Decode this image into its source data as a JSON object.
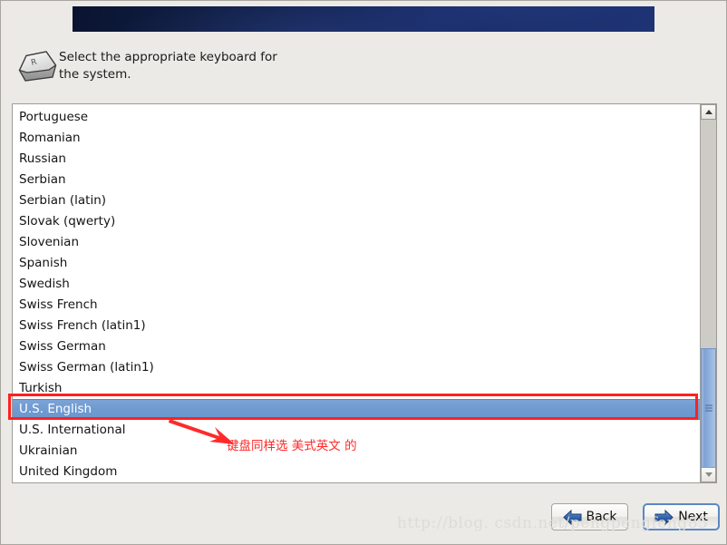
{
  "window": {
    "background_color": "#eceae6",
    "banner_color_start": "#0a1430",
    "banner_color_end": "#1e3374"
  },
  "header": {
    "icon": "keyboard-key-icon",
    "icon_letter": "R",
    "prompt": "Select the appropriate keyboard for\nthe system."
  },
  "keyboard_list": {
    "items": [
      {
        "label": "Portuguese",
        "selected": false
      },
      {
        "label": "Romanian",
        "selected": false
      },
      {
        "label": "Russian",
        "selected": false
      },
      {
        "label": "Serbian",
        "selected": false
      },
      {
        "label": "Serbian (latin)",
        "selected": false
      },
      {
        "label": "Slovak (qwerty)",
        "selected": false
      },
      {
        "label": "Slovenian",
        "selected": false
      },
      {
        "label": "Spanish",
        "selected": false
      },
      {
        "label": "Swedish",
        "selected": false
      },
      {
        "label": "Swiss French",
        "selected": false
      },
      {
        "label": "Swiss French (latin1)",
        "selected": false
      },
      {
        "label": "Swiss German",
        "selected": false
      },
      {
        "label": "Swiss German (latin1)",
        "selected": false
      },
      {
        "label": "Turkish",
        "selected": false
      },
      {
        "label": "U.S. English",
        "selected": true
      },
      {
        "label": "U.S. International",
        "selected": false
      },
      {
        "label": "Ukrainian",
        "selected": false
      },
      {
        "label": "United Kingdom",
        "selected": false
      }
    ],
    "selected_value": "U.S. English",
    "selection_color": "#6f9ad1",
    "scrollbar": {
      "up_arrow": "chevron-up-icon",
      "down_arrow": "chevron-down-icon",
      "thumb_color": "#8fb0dd"
    }
  },
  "annotation": {
    "note": "键盘同样选 美式英文 的",
    "color": "#ff2a2a",
    "highlight_target": "U.S. English"
  },
  "footer": {
    "back_label": "Back",
    "back_icon": "arrow-left-icon",
    "next_label": "Next",
    "next_icon": "arrow-right-icon",
    "watermark": "http://blog. csdn.net/pengpengfeng85"
  }
}
